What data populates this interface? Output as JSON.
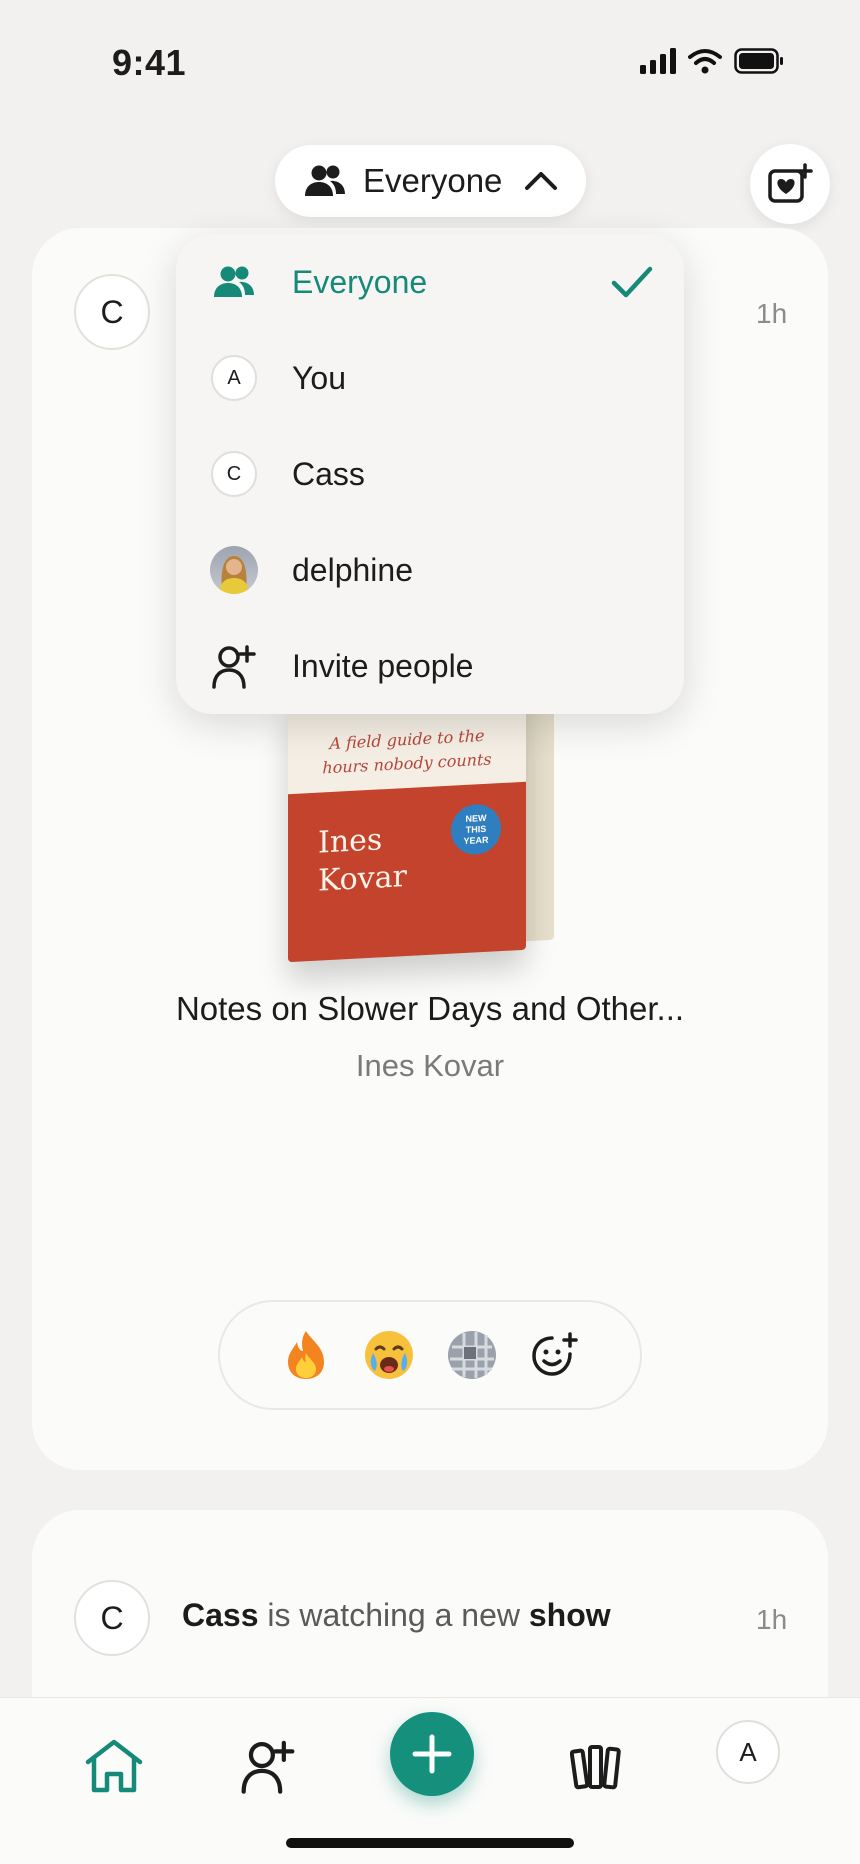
{
  "status_bar": {
    "time": "9:41"
  },
  "header": {
    "filter_label": "Everyone",
    "favorite_icon": "heart-plus-icon"
  },
  "feed": {
    "card1": {
      "avatar_initial": "C",
      "time_ago": "1h",
      "book": {
        "tagline_line1": "A field guide to the",
        "tagline_line2": "hours nobody counts",
        "cover_author_first": "Ines",
        "cover_author_last": "Kovar",
        "badge_line1": "NEW",
        "badge_line2": "THIS",
        "badge_line3": "YEAR",
        "title": "Notes on Slower Days and Other...",
        "author": "Ines Kovar"
      },
      "reactions": [
        "fire-emoji",
        "crying-face-emoji",
        "grid-emoji",
        "add-reaction-icon"
      ]
    },
    "card2": {
      "avatar_initial": "C",
      "time_ago": "1h",
      "activity_user": "Cass",
      "activity_middle": " is watching a new ",
      "activity_object": "show"
    }
  },
  "dropdown": {
    "items": [
      {
        "label": "Everyone",
        "icon": "people-icon",
        "selected": true
      },
      {
        "label": "You",
        "initial": "A"
      },
      {
        "label": "Cass",
        "initial": "C"
      },
      {
        "label": "delphine",
        "icon": "photo-avatar"
      },
      {
        "label": "Invite people",
        "icon": "add-person-icon"
      }
    ]
  },
  "tab_bar": {
    "items": [
      "home-icon",
      "add-friend-icon",
      "add-button",
      "library-icon",
      "profile-avatar"
    ],
    "profile_initial": "A"
  },
  "colors": {
    "accent": "#168a78",
    "background": "#f2f1ef",
    "card": "#fbfbfa"
  }
}
